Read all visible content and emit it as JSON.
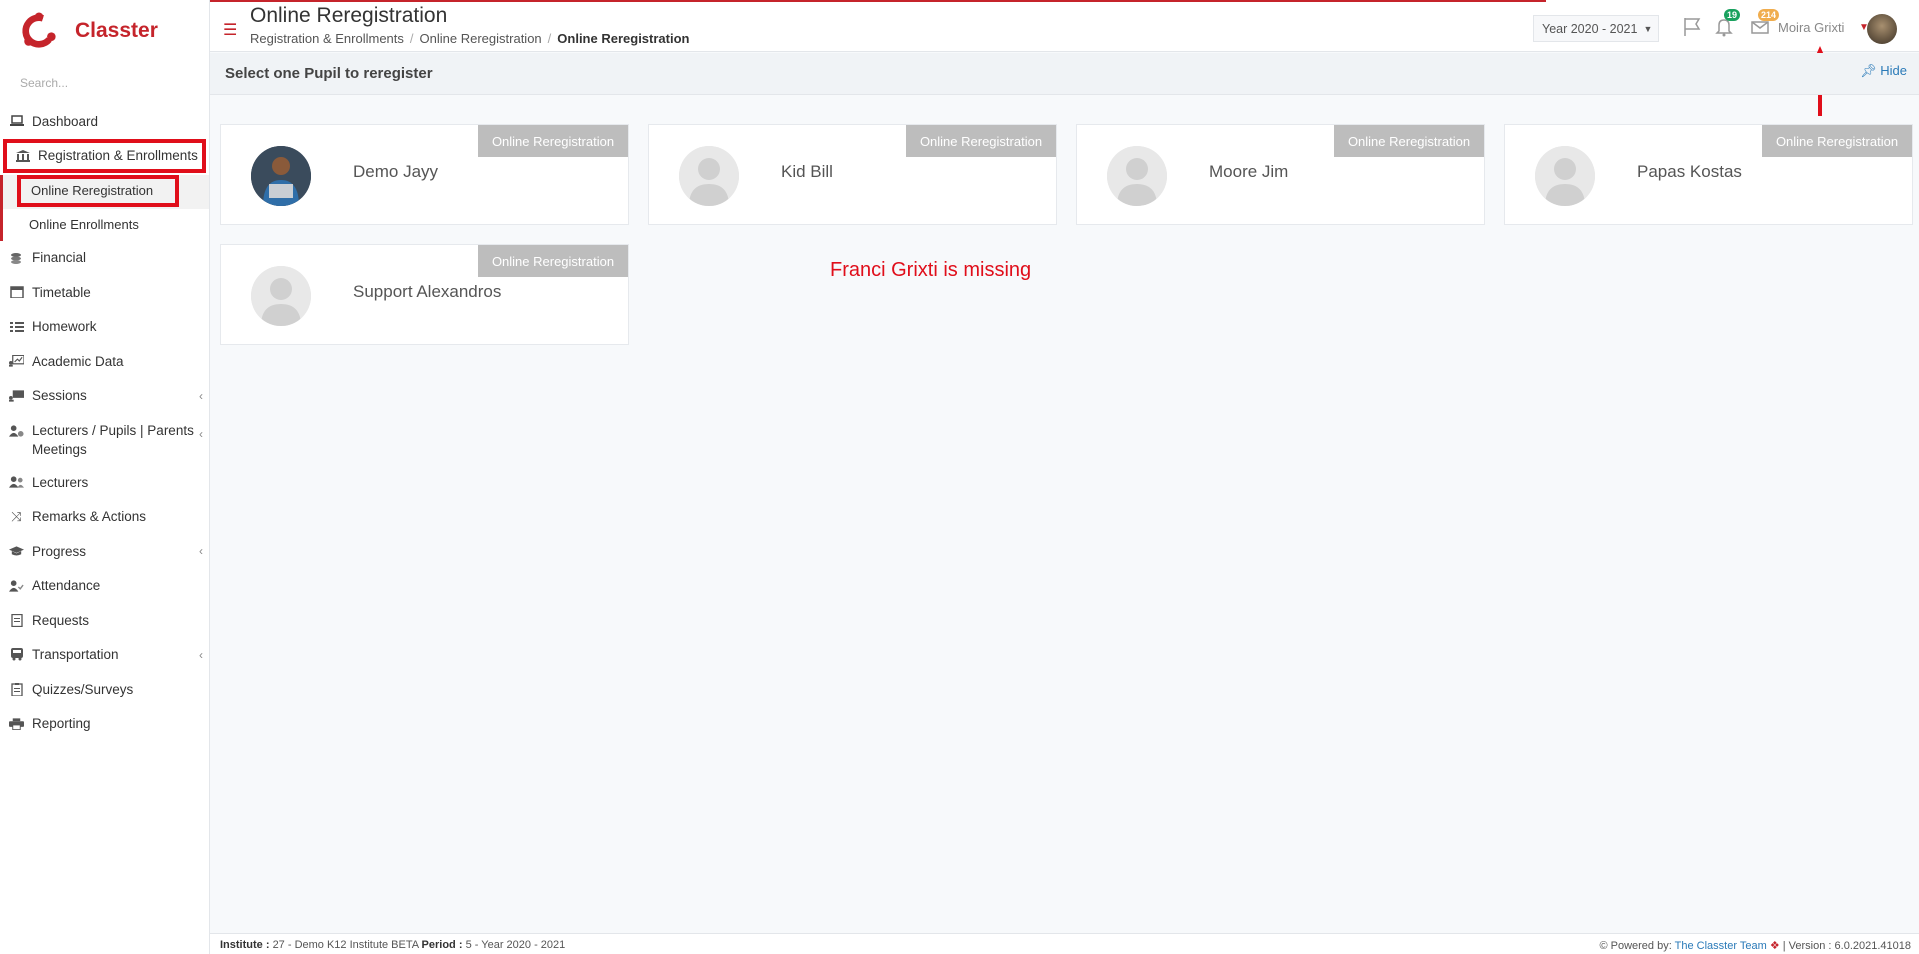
{
  "brand": {
    "name": "Classter",
    "color": "#c5242b"
  },
  "search": {
    "placeholder": "Search..."
  },
  "sidebar": {
    "items": [
      {
        "label": "Dashboard",
        "icon": "laptop-icon"
      },
      {
        "label": "Registration & Enrollments",
        "icon": "institution-icon"
      },
      {
        "label": "Financial",
        "icon": "coins-icon"
      },
      {
        "label": "Timetable",
        "icon": "calendar-icon"
      },
      {
        "label": "Homework",
        "icon": "list-check-icon"
      },
      {
        "label": "Academic Data",
        "icon": "chart-board-icon"
      },
      {
        "label": "Sessions",
        "icon": "sessions-icon"
      },
      {
        "label": "Lecturers / Pupils | Parents Meetings",
        "icon": "user-group-icon"
      },
      {
        "label": "Lecturers",
        "icon": "users-icon"
      },
      {
        "label": "Remarks & Actions",
        "icon": "shuffle-icon"
      },
      {
        "label": "Progress",
        "icon": "graduation-cap-icon"
      },
      {
        "label": "Attendance",
        "icon": "user-check-icon"
      },
      {
        "label": "Requests",
        "icon": "document-icon"
      },
      {
        "label": "Transportation",
        "icon": "bus-icon"
      },
      {
        "label": "Quizzes/Surveys",
        "icon": "clipboard-icon"
      },
      {
        "label": "Reporting",
        "icon": "printer-icon"
      }
    ],
    "sub": [
      "Online Reregistration",
      "Online Enrollments"
    ]
  },
  "header": {
    "title": "Online Reregistration",
    "breadcrumb": [
      "Registration & Enrollments",
      "Online Reregistration",
      "Online Reregistration"
    ],
    "year": "Year 2020 - 2021",
    "notifications": "19",
    "messages": "214",
    "user": "Moira Grixti"
  },
  "section": {
    "title": "Select one Pupil to reregister",
    "hide": "Hide"
  },
  "pupils": [
    {
      "name": "Demo Jayy",
      "tag": "Online Reregistration",
      "photo": true
    },
    {
      "name": "Kid Bill",
      "tag": "Online Reregistration",
      "photo": false
    },
    {
      "name": "Moore Jim",
      "tag": "Online Reregistration",
      "photo": false
    },
    {
      "name": "Papas Kostas",
      "tag": "Online Reregistration",
      "photo": false
    },
    {
      "name": "Support Alexandros",
      "tag": "Online Reregistration",
      "photo": false
    }
  ],
  "annotation": {
    "note": "Franci Grixti is missing",
    "color": "#e00e1a"
  },
  "footer": {
    "institute_label": "Institute :",
    "institute": "27 - Demo K12 Institute BETA",
    "period_label": "Period :",
    "period": "5 - Year 2020 - 2021",
    "powered": "Powered by:",
    "team": "The Classter Team",
    "version": "| Version : 6.0.2021.41018"
  }
}
